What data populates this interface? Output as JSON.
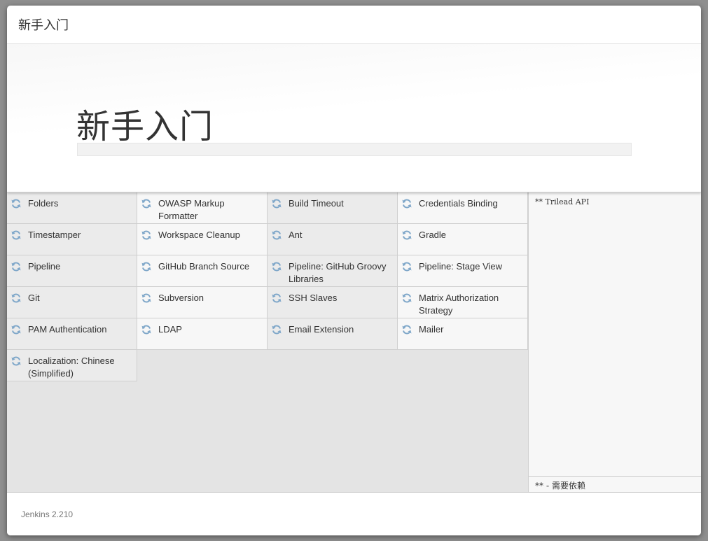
{
  "dialog": {
    "title": "新手入门"
  },
  "jumbotron": {
    "heading": "新手入门",
    "progress_percent": 0
  },
  "plugins": [
    {
      "name": "Folders"
    },
    {
      "name": "OWASP Markup Formatter"
    },
    {
      "name": "Build Timeout"
    },
    {
      "name": "Credentials Binding"
    },
    {
      "name": "Timestamper"
    },
    {
      "name": "Workspace Cleanup"
    },
    {
      "name": "Ant"
    },
    {
      "name": "Gradle"
    },
    {
      "name": "Pipeline"
    },
    {
      "name": "GitHub Branch Source"
    },
    {
      "name": "Pipeline: GitHub Groovy Libraries"
    },
    {
      "name": "Pipeline: Stage View"
    },
    {
      "name": "Git"
    },
    {
      "name": "Subversion"
    },
    {
      "name": "SSH Slaves"
    },
    {
      "name": "Matrix Authorization Strategy"
    },
    {
      "name": "PAM Authentication"
    },
    {
      "name": "LDAP"
    },
    {
      "name": "Email Extension"
    },
    {
      "name": "Mailer"
    },
    {
      "name": "Localization: Chinese (Simplified)"
    }
  ],
  "plugin_icon": "refresh-icon",
  "log": {
    "text": "** Trilead API",
    "footer": "** - 需要依赖"
  },
  "footer": {
    "version": "Jenkins 2.210"
  },
  "colors": {
    "icon": "#7fa7c9",
    "progress": "#d24939"
  }
}
